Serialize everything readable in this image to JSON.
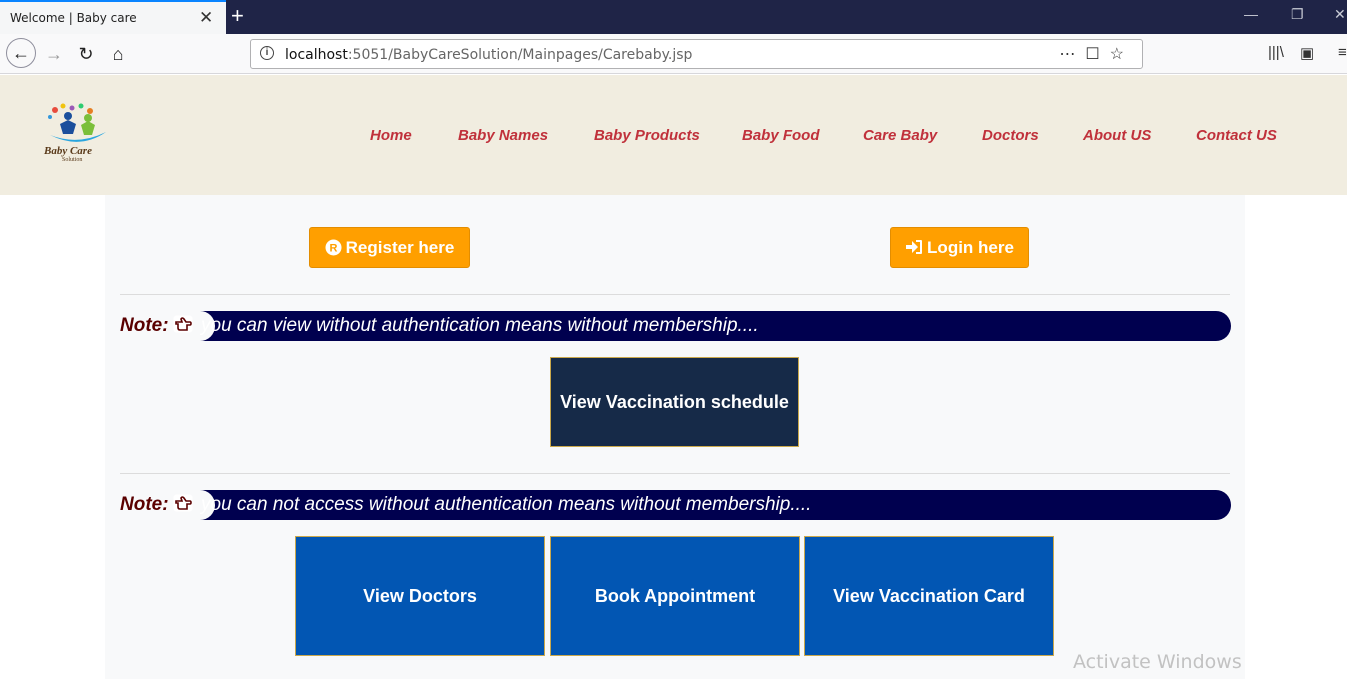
{
  "browser": {
    "tab_title": "Welcome | Baby care",
    "url_host": "localhost",
    "url_path": ":5051/BabyCareSolution/Mainpages/Carebaby.jsp"
  },
  "site": {
    "logo_text": "Baby Care",
    "logo_sub": "Solution",
    "menu": [
      "Home",
      "Baby Names",
      "Baby Products",
      "Baby Food",
      "Care Baby",
      "Doctors",
      "About US",
      "Contact US"
    ]
  },
  "auth": {
    "register": "Register here",
    "login": "Login here"
  },
  "notes": {
    "label": "Note:",
    "public_text": "you can view without authentication means without membership....",
    "private_text": "you can not access without authentication means without membership...."
  },
  "actions": {
    "view_vaccination_schedule": "View Vaccination schedule",
    "view_doctors": "View Doctors",
    "book_appointment": "Book Appointment",
    "view_vaccination_card": "View Vaccination Card"
  },
  "overlay": {
    "activate_windows": "Activate Windows"
  },
  "colors": {
    "menu": "#c0313b",
    "orange": "#ff9f00",
    "note_bar": "#00004f",
    "card_dark": "#162a48",
    "card_blue": "#0256b3",
    "header_bg": "#f1ede0"
  }
}
